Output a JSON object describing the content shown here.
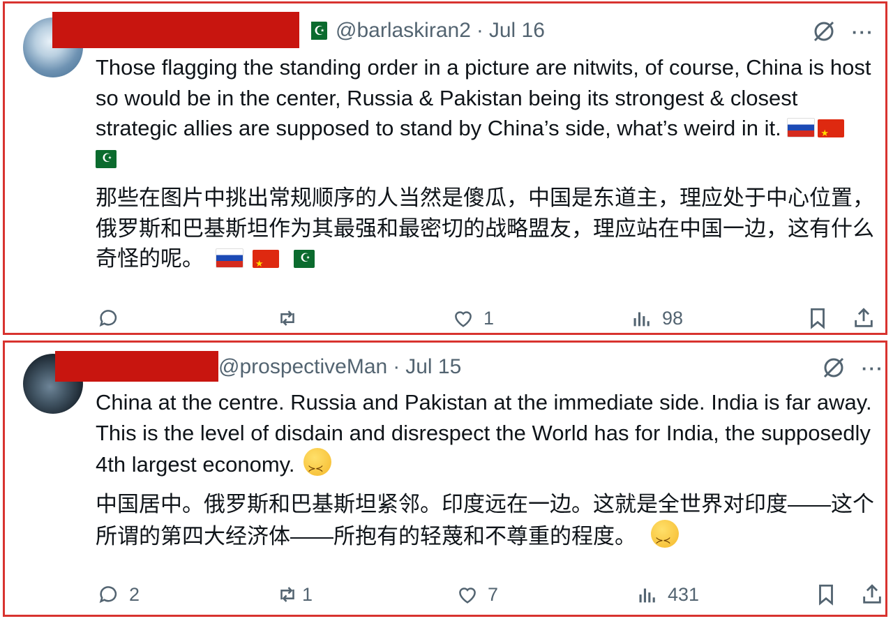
{
  "tweets": [
    {
      "handle": "@barlaskiran2",
      "separator": "·",
      "date": "Jul 16",
      "flag_icon": "pakistan-flag",
      "text_en": "Those flagging the standing order in a picture are nitwits, of course, China is host so would be in the center, Russia & Pakistan being its strongest & closest strategic allies are supposed to stand by China’s side, what’s weird in it.",
      "text_zh": "那些在图片中挑出常规顺序的人当然是傻瓜，中国是东道主，理应处于中心位置，俄罗斯和巴基斯坦作为其最强和最密切的战略盟友，理应站在中国一边，这有什么奇怪的呢。",
      "counts": {
        "replies": "",
        "reposts": "",
        "likes": "1",
        "views": "98"
      }
    },
    {
      "handle": "@prospectiveMan",
      "separator": "·",
      "date": "Jul 15",
      "text_en": "China at the centre. Russia and Pakistan at the immediate side. India is far away. This is the level of disdain and disrespect the World has for India, the supposedly 4th largest economy.",
      "text_zh": "中国居中。俄罗斯和巴基斯坦紧邻。印度远在一边。这就是全世界对印度——这个所谓的第四大经济体——所抱有的轻蔑和不尊重的程度。",
      "counts": {
        "replies": "2",
        "reposts": "1",
        "likes": "7",
        "views": "431"
      }
    }
  ],
  "icons": {
    "grok": "slashed-circle-icon",
    "more": "···",
    "reply": "speech-bubble-icon",
    "repost": "repost-arrows-icon",
    "like": "heart-icon",
    "views": "bar-chart-icon",
    "bookmark": "bookmark-icon",
    "share": "share-upload-icon"
  },
  "colors": {
    "border": "#d8332f",
    "redaction": "#c8150f",
    "muted": "#536471",
    "text": "#0f1419"
  }
}
